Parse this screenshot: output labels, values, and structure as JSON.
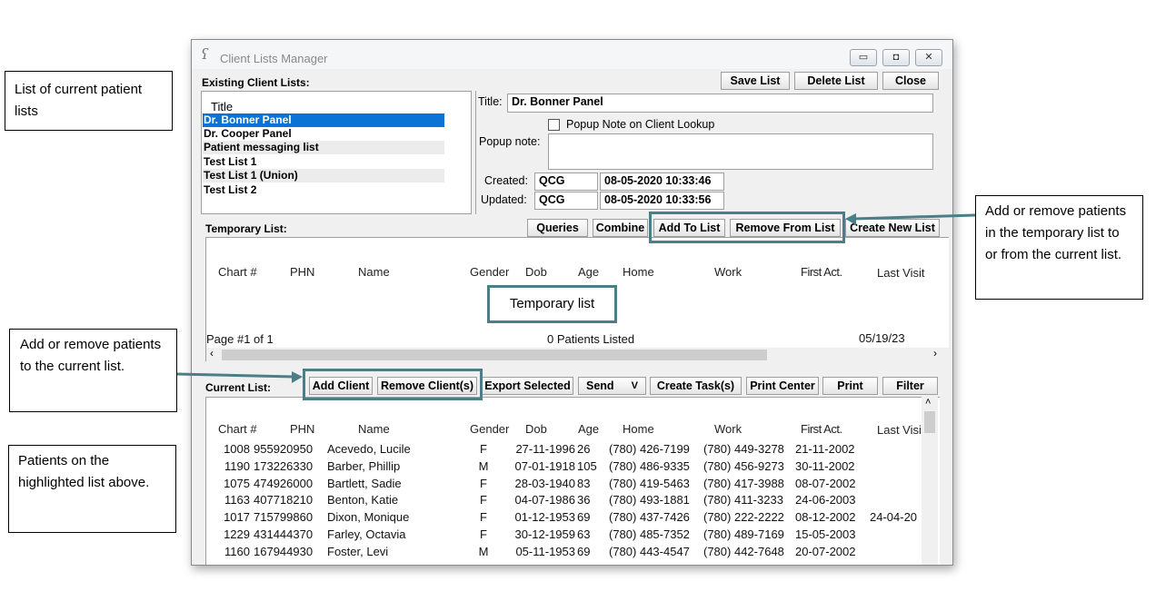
{
  "callouts": {
    "current_lists": "List of current patient lists",
    "add_remove_temp": "Add or remove patients in the temporary list to or from the current list.",
    "add_remove_current": "Add or remove patients to the current list.",
    "patients_highlighted": "Patients on the highlighted list above.",
    "temporary_list": "Temporary list"
  },
  "window": {
    "title": "Client Lists Manager",
    "minimize": "▭",
    "maximize": "◘",
    "close": "✕"
  },
  "existing": {
    "label": "Existing Client Lists:",
    "save_list": "Save List",
    "delete_list": "Delete List",
    "close": "Close",
    "list_header": "Title",
    "items": [
      "Dr. Bonner Panel",
      "Dr. Cooper Panel",
      "Patient messaging list",
      "Test List 1",
      "Test List 1 (Union)",
      "Test List 2"
    ]
  },
  "details": {
    "title_label": "Title:",
    "title_value": "Dr. Bonner Panel",
    "popup_checkbox": "Popup Note on Client Lookup",
    "popup_note_label": "Popup note:",
    "created_label": "Created:",
    "created_user": "QCG",
    "created_date": "08-05-2020 10:33:46",
    "updated_label": "Updated:",
    "updated_user": "QCG",
    "updated_date": "08-05-2020 10:33:56"
  },
  "temporary": {
    "label": "Temporary List:",
    "queries": "Queries",
    "combine": "Combine",
    "add_to_list": "Add To List",
    "remove_from_list": "Remove From List",
    "create_new_list": "Create New List",
    "page": "Page #1 of 1",
    "count": "0 Patients Listed",
    "date": "05/19/23"
  },
  "columns": [
    "Chart #",
    "PHN",
    "Name",
    "Gender",
    "Dob",
    "Age",
    "Home",
    "Work",
    "First Act.",
    "Last Visit"
  ],
  "current": {
    "label": "Current List:",
    "add_client": "Add Client",
    "remove_clients": "Remove Client(s)",
    "export_selected": "Export Selected",
    "send": "Send",
    "send_arrow": "V",
    "create_tasks": "Create Task(s)",
    "print_center": "Print Center",
    "print": "Print",
    "filter": "Filter",
    "last_visit_header": "Last Visi",
    "rows": [
      {
        "chart": "1008",
        "phn": "955920950",
        "name": "Acevedo, Lucile",
        "gender": "F",
        "dob": "27-11-1996",
        "age": "26",
        "home": "(780) 426-7199",
        "work": "(780) 449-3278",
        "first": "21-11-2002",
        "last": ""
      },
      {
        "chart": "1190",
        "phn": "173226330",
        "name": "Barber, Phillip",
        "gender": "M",
        "dob": "07-01-1918",
        "age": "105",
        "home": "(780) 486-9335",
        "work": "(780) 456-9273",
        "first": "30-11-2002",
        "last": ""
      },
      {
        "chart": "1075",
        "phn": "474926000",
        "name": "Bartlett, Sadie",
        "gender": "F",
        "dob": "28-03-1940",
        "age": "83",
        "home": "(780) 419-5463",
        "work": "(780) 417-3988",
        "first": "08-07-2002",
        "last": ""
      },
      {
        "chart": "1163",
        "phn": "407718210",
        "name": "Benton, Katie",
        "gender": "F",
        "dob": "04-07-1986",
        "age": "36",
        "home": "(780) 493-1881",
        "work": "(780) 411-3233",
        "first": "24-06-2003",
        "last": ""
      },
      {
        "chart": "1017",
        "phn": "715799860",
        "name": "Dixon, Monique",
        "gender": "F",
        "dob": "01-12-1953",
        "age": "69",
        "home": "(780) 437-7426",
        "work": "(780) 222-2222",
        "first": "08-12-2002",
        "last": "24-04-20"
      },
      {
        "chart": "1229",
        "phn": "431444370",
        "name": "Farley, Octavia",
        "gender": "F",
        "dob": "30-12-1959",
        "age": "63",
        "home": "(780) 485-7352",
        "work": "(780) 489-7169",
        "first": "15-05-2003",
        "last": ""
      },
      {
        "chart": "1160",
        "phn": "167944930",
        "name": "Foster, Levi",
        "gender": "M",
        "dob": "05-11-1953",
        "age": "69",
        "home": "(780) 443-4547",
        "work": "(780) 442-7648",
        "first": "20-07-2002",
        "last": ""
      }
    ]
  },
  "colors": {
    "highlight": "#4b7e88",
    "selection": "#0b72d6"
  }
}
